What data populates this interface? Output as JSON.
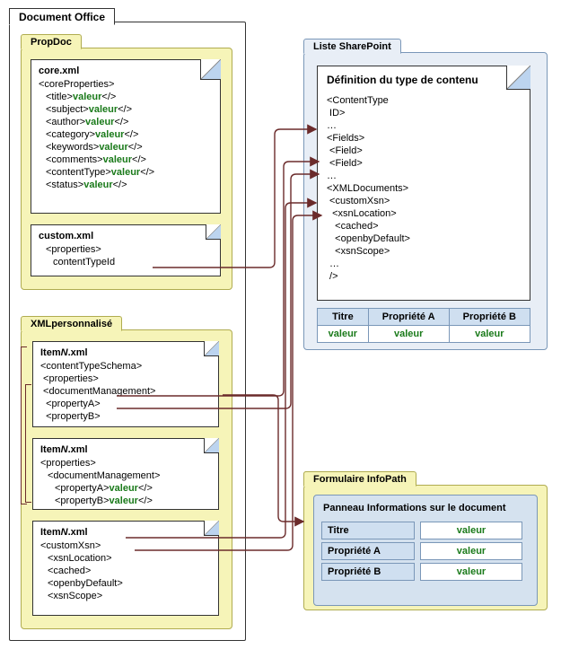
{
  "docOffice": {
    "title": "Document Office"
  },
  "propDoc": {
    "title": "PropDoc",
    "core": {
      "file": "core.xml",
      "root": "<coreProperties>",
      "lines": [
        {
          "open": "<title>",
          "val": "valeur",
          "close": "</>"
        },
        {
          "open": "<subject>",
          "val": "valeur",
          "close": "</>"
        },
        {
          "open": "<author>",
          "val": "valeur",
          "close": "</>"
        },
        {
          "open": "<category>",
          "val": "valeur",
          "close": "</>"
        },
        {
          "open": "<keywords>",
          "val": "valeur",
          "close": "</>"
        },
        {
          "open": "<comments>",
          "val": "valeur",
          "close": "</>"
        },
        {
          "open": "<contentType>",
          "val": "valeur",
          "close": "</>"
        },
        {
          "open": "<status>",
          "val": "valeur",
          "close": "</>"
        }
      ]
    },
    "custom": {
      "file": "custom.xml",
      "root": "<properties>",
      "child": "contentTypeId"
    }
  },
  "xmlPers": {
    "title": "XMLpersonnalisé",
    "itemA": {
      "file": "ItemN.xml",
      "lines": [
        "<contentTypeSchema>",
        " <properties>",
        " <documentManagement>",
        "  <propertyA>",
        "  <propertyB>"
      ]
    },
    "itemB": {
      "file": "ItemN.xml",
      "root": "<properties>",
      "mgmt": "<documentManagement>",
      "pA_open": "<propertyA>",
      "pA_val": "valeur",
      "pA_close": "</>",
      "pB_open": "<propertyB>",
      "pB_val": "valeur",
      "pB_close": "</>"
    },
    "itemC": {
      "file": "ItemN.xml",
      "root": "<customXsn>",
      "children": [
        "<xsnLocation>",
        "<cached>",
        "<openbyDefault>",
        "<xsnScope>"
      ]
    }
  },
  "sharepoint": {
    "title": "Liste SharePoint",
    "docTitle": "Définition du type de contenu",
    "lines": [
      "<ContentType",
      " ID>",
      "…",
      "<Fields>",
      " <Field>",
      " <Field>",
      "…",
      "<XMLDocuments>",
      " <customXsn>",
      "  <xsnLocation>",
      "   <cached>",
      "   <openbyDefault>",
      "   <xsnScope>",
      " …",
      " />"
    ],
    "table": {
      "headers": [
        "Titre",
        "Propriété A",
        "Propriété B"
      ],
      "row": [
        "valeur",
        "valeur",
        "valeur"
      ]
    }
  },
  "infopath": {
    "title": "Formulaire InfoPath",
    "panelTitle": "Panneau Informations sur le document",
    "rows": [
      {
        "label": "Titre",
        "value": "valeur"
      },
      {
        "label": "Propriété A",
        "value": "valeur"
      },
      {
        "label": "Propriété B",
        "value": "valeur"
      }
    ]
  }
}
